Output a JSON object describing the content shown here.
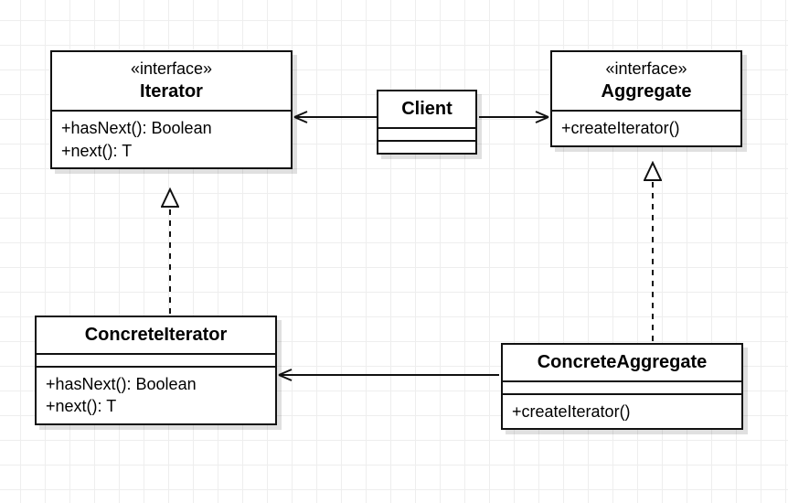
{
  "classes": {
    "iterator": {
      "stereotype": "«interface»",
      "name": "Iterator",
      "ops": [
        "+hasNext(): Boolean",
        "+next(): T"
      ]
    },
    "aggregate": {
      "stereotype": "«interface»",
      "name": "Aggregate",
      "ops": [
        "+createIterator()"
      ]
    },
    "client": {
      "name": "Client"
    },
    "concreteIterator": {
      "name": "ConcreteIterator",
      "ops": [
        "+hasNext(): Boolean",
        "+next(): T"
      ]
    },
    "concreteAggregate": {
      "name": "ConcreteAggregate",
      "ops": [
        "+createIterator()"
      ]
    }
  },
  "relationships": [
    {
      "from": "Client",
      "to": "Iterator",
      "type": "association-directed"
    },
    {
      "from": "Client",
      "to": "Aggregate",
      "type": "association-directed"
    },
    {
      "from": "ConcreteIterator",
      "to": "Iterator",
      "type": "realization"
    },
    {
      "from": "ConcreteAggregate",
      "to": "Aggregate",
      "type": "realization"
    },
    {
      "from": "ConcreteAggregate",
      "to": "ConcreteIterator",
      "type": "association-directed"
    }
  ]
}
